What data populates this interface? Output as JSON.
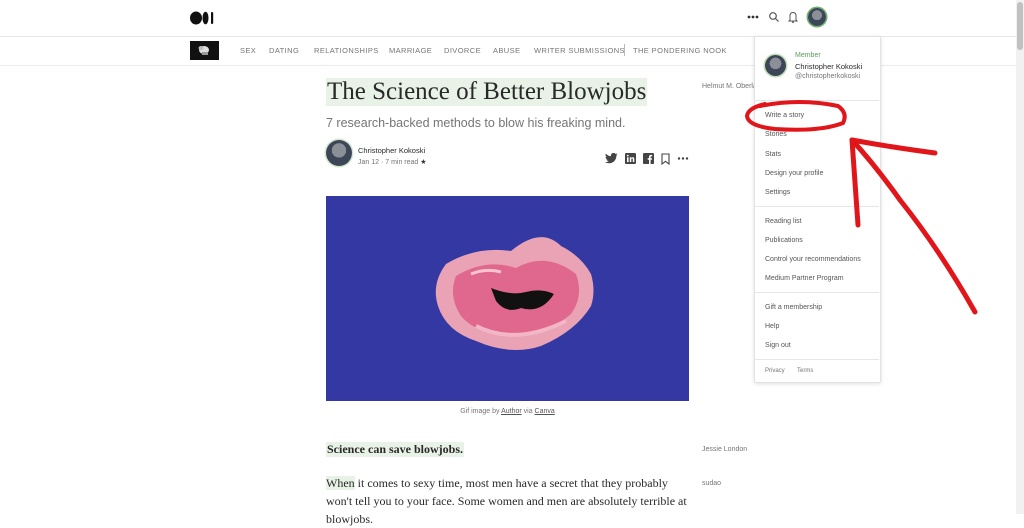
{
  "topbar": {
    "logo_icon": "medium-logo-icon",
    "more_icon": "more-dots-icon",
    "search_icon": "search-icon",
    "bell_icon": "bell-icon"
  },
  "nav": {
    "items": [
      "SEX",
      "DATING",
      "RELATIONSHIPS",
      "MARRIAGE",
      "DIVORCE",
      "ABUSE",
      "WRITER SUBMISSIONS",
      "THE PONDERING NOOK"
    ]
  },
  "article": {
    "title": "The Science of Better Blowjobs",
    "subtitle": "7 research-backed methods to blow his freaking mind.",
    "author": "Christopher Kokoski",
    "meta": "Jan 12 · 7 min read",
    "star": "★",
    "caption_prefix": "Gif image by",
    "caption_author": "Author",
    "caption_via": "via",
    "caption_source": "Canva",
    "para_head": "Science can save blowjobs.",
    "para_when": "When",
    "para_rest_line1": " it comes to sexy time, most men have a secret that they probably",
    "para_line2": "won't tell you to your face. Some women and men are absolutely terrible at",
    "para_line3": "blowjobs."
  },
  "side_notes": {
    "note1": "Helmut M. Oberla",
    "note2": "Jessie London",
    "note3": "sudao"
  },
  "menu": {
    "member_label": "Member",
    "name": "Christopher Kokoski",
    "handle": "@christopherkokoski",
    "group1": [
      "Write a story",
      "Stories",
      "Stats",
      "Design your profile",
      "Settings"
    ],
    "group2": [
      "Reading list",
      "Publications",
      "Control your recommendations",
      "Medium Partner Program"
    ],
    "group3": [
      "Gift a membership",
      "Help",
      "Sign out"
    ],
    "privacy": "Privacy",
    "terms": "Terms"
  },
  "colors": {
    "highlight": "#e9f2e6",
    "member_green": "#5aa05a",
    "hero_bg": "#3438a3",
    "annotation_red": "#e0161b"
  }
}
